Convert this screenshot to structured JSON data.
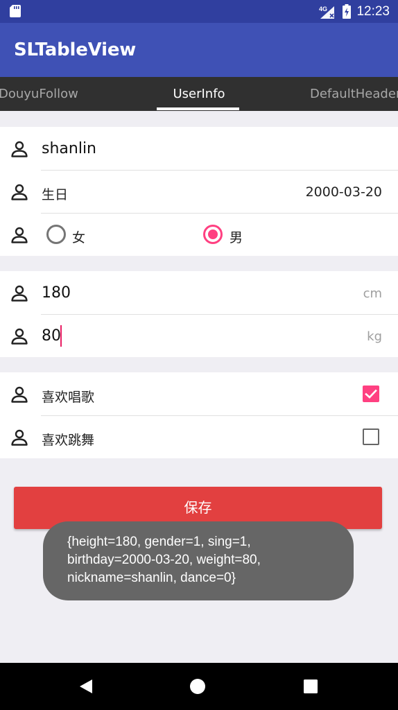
{
  "status_bar": {
    "time": "12:23",
    "network": "4G",
    "icons": [
      "sd-card-icon",
      "network-4g-icon",
      "battery-charging-icon"
    ]
  },
  "app_bar": {
    "title": "SLTableView"
  },
  "tabs": [
    {
      "label": "DouyuFollow",
      "selected": false
    },
    {
      "label": "UserInfo",
      "selected": true
    },
    {
      "label": "DefaultHeader",
      "selected": false
    }
  ],
  "form": {
    "nickname": "shanlin",
    "birthday": {
      "label": "生日",
      "value": "2000-03-20"
    },
    "gender": {
      "options": [
        {
          "label": "女",
          "selected": false
        },
        {
          "label": "男",
          "selected": true
        }
      ]
    },
    "height": {
      "value": "180",
      "unit": "cm"
    },
    "weight": {
      "value": "80",
      "unit": "kg"
    },
    "sing": {
      "label": "喜欢唱歌",
      "checked": true
    },
    "dance": {
      "label": "喜欢跳舞",
      "checked": false
    }
  },
  "save_button": {
    "label": "保存"
  },
  "toast": {
    "lines": [
      "{height=180, gender=1, sing=1,",
      "birthday=2000-03-20, weight=80,",
      "nickname=shanlin, dance=0}"
    ]
  },
  "colors": {
    "status_bar": "#303f9f",
    "app_bar": "#3f51b5",
    "tab_bar": "#303030",
    "accent": "#ff4081",
    "save_button": "#e24040",
    "toast": "#666666",
    "background": "#efeef3"
  },
  "nav_bar": {
    "icons": [
      "back-icon",
      "home-icon",
      "recents-icon"
    ]
  }
}
